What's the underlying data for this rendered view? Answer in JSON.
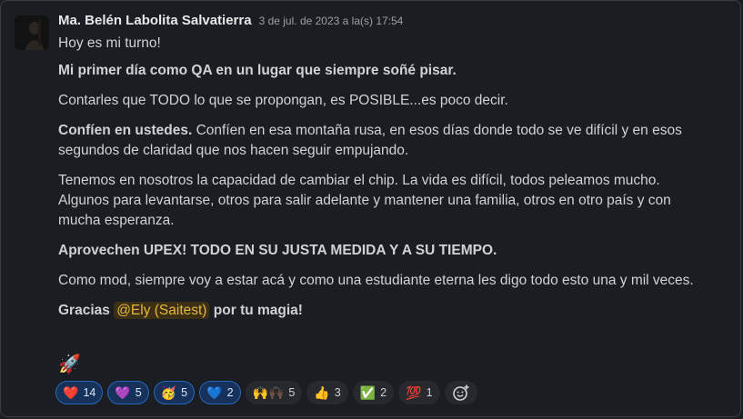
{
  "message": {
    "author": "Ma. Belén Labolita Salvatierra",
    "timestamp": "3 de jul. de 2023 a la(s) 17:54",
    "lines": {
      "l1": "Hoy es mi turno!",
      "l2": "Mi primer día como QA en un lugar que siempre soñé pisar.",
      "l3": "Contarles que TODO lo que se propongan, es POSIBLE...es poco decir.",
      "l4_bold": "Confíen en ustedes.",
      "l4_rest_a": " Confíen en esa montaña rusa, en esos días donde todo se ve difícil y en esos",
      "l4_rest_b": "segundos de claridad que nos hacen seguir empujando.",
      "l5_a": "Tenemos en nosotros la capacidad de cambiar el chip. La vida es difícil, todos peleamos mucho.",
      "l5_b": "Algunos para levantarse, otros para salir adelante y mantener una familia, otros en otro país y con",
      "l5_c": "mucha esperanza.",
      "l6": "Aprovechen UPEX! TODO EN SU JUSTA MEDIDA Y A SU TIEMPO.",
      "l7": "Como mod, siempre voy a estar acá y como una estudiante eterna les digo todo esto una y mil veces.",
      "l8_pre": "Gracias ",
      "l8_mention": "@Ely (Saitest)",
      "l8_post": " por tu magia!",
      "rocket": "🚀"
    }
  },
  "reactions": [
    {
      "emoji": "❤️",
      "name": "heart",
      "count": "14",
      "selected": true
    },
    {
      "emoji": "💜",
      "name": "purple-heart",
      "count": "5",
      "selected": true
    },
    {
      "emoji": "🥳",
      "name": "partying-face",
      "count": "5",
      "selected": true
    },
    {
      "emoji": "💙",
      "name": "blue-heart",
      "count": "2",
      "selected": true
    },
    {
      "emoji": "🙌🙌🏿",
      "name": "raised-hands",
      "count": "5",
      "selected": false
    },
    {
      "emoji": "👍",
      "name": "thumbs-up",
      "count": "3",
      "selected": false
    },
    {
      "emoji": "✅",
      "name": "check-mark",
      "count": "2",
      "selected": false
    },
    {
      "emoji": "💯",
      "name": "hundred-points",
      "count": "1",
      "selected": false
    }
  ],
  "colors": {
    "background": "#1a1d21",
    "mention_bg": "#3b2f15",
    "mention_text": "#e8b83d",
    "selected_chip_bg": "#17325a",
    "selected_chip_border": "#2a66b8"
  }
}
